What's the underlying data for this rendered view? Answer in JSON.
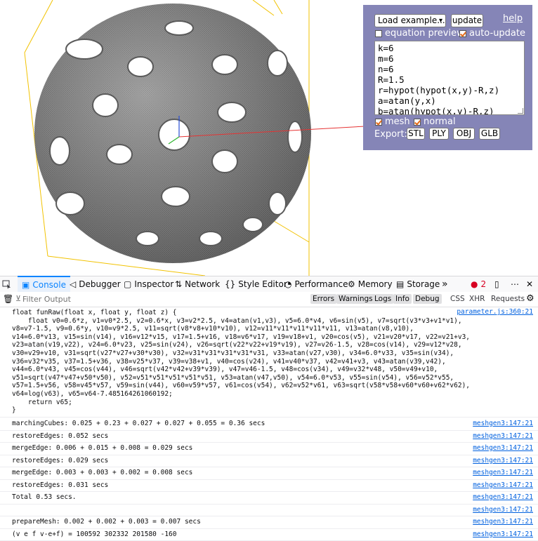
{
  "panel": {
    "example_select": "Load example...",
    "update_label": "update",
    "help_label": "help",
    "equation_preview_label": "equation preview",
    "equation_preview_checked": false,
    "auto_update_label": "auto-update",
    "auto_update_checked": true,
    "equation_lines": [
      "k=6",
      "m=6",
      "n=6",
      "R=1.5",
      "r=hypot(hypot(x,y)-R,z)",
      "a=atan(y,x)",
      "b=atan(hypot(x,y)-R,z)"
    ],
    "mesh_label": "mesh",
    "mesh_checked": true,
    "normal_label": "normal",
    "normal_checked": true,
    "export_label": "Export:",
    "export_buttons": [
      "STL",
      "PLY",
      "OBJ",
      "GLB"
    ],
    "background_color": "#8585b7"
  },
  "devtools": {
    "tabs": [
      {
        "label": "Console",
        "icon": "console-icon",
        "active": true
      },
      {
        "label": "Debugger",
        "icon": "debugger-icon"
      },
      {
        "label": "Inspector",
        "icon": "inspector-icon"
      },
      {
        "label": "Network",
        "icon": "network-icon"
      },
      {
        "label": "Style Editor",
        "icon": "style-editor-icon"
      },
      {
        "label": "Performance",
        "icon": "performance-icon"
      },
      {
        "label": "Memory",
        "icon": "memory-icon"
      },
      {
        "label": "Storage",
        "icon": "storage-icon"
      }
    ],
    "error_count": "2",
    "filter_placeholder": "Filter Output",
    "filters": [
      "Errors",
      "Warnings",
      "Logs",
      "Info",
      "Debug"
    ],
    "plain_filters": [
      "CSS",
      "XHR",
      "Requests"
    ],
    "accent_color": "#0a84ff"
  },
  "console": {
    "code_source": "parameter.js:360:21",
    "code_lines": [
      "float funRaw(float x, float y, float z) {",
      "    float v0=0.6*z, v1=v0*2.5, v2=0.6*x, v3=v2*2.5, v4=atan(v1,v3), v5=6.0*v4, v6=sin(v5), v7=sqrt(v3*v3+v1*v1),",
      "v8=v7-1.5, v9=0.6*y, v10=v9*2.5, v11=sqrt(v8*v8+v10*v10), v12=v11*v11*v11*v11*v11, v13=atan(v8,v10),",
      "v14=6.0*v13, v15=sin(v14), v16=v12*v15, v17=1.5+v16, v18=v6*v17, v19=v18+v1, v20=cos(v5), v21=v20*v17, v22=v21+v3,",
      "v23=atan(v19,v22), v24=6.0*v23, v25=sin(v24), v26=sqrt(v22*v22+v19*v19), v27=v26-1.5, v28=cos(v14), v29=v12*v28,",
      "v30=v29+v10, v31=sqrt(v27*v27+v30*v30), v32=v31*v31*v31*v31*v31, v33=atan(v27,v30), v34=6.0*v33, v35=sin(v34),",
      "v36=v32*v35, v37=1.5+v36, v38=v25*v37, v39=v38+v1, v40=cos(v24), v41=v40*v37, v42=v41+v3, v43=atan(v39,v42),",
      "v44=6.0*v43, v45=cos(v44), v46=sqrt(v42*v42+v39*v39), v47=v46-1.5, v48=cos(v34), v49=v32*v48, v50=v49+v10,",
      "v51=sqrt(v47*v47+v50*v50), v52=v51*v51*v51*v51*v51, v53=atan(v47,v50), v54=6.0*v53, v55=sin(v54), v56=v52*v55,",
      "v57=1.5+v56, v58=v45*v57, v59=sin(v44), v60=v59*v57, v61=cos(v54), v62=v52*v61, v63=sqrt(v58*v58+v60*v60+v62*v62),",
      "v64=log(v63), v65=v64-7.485164261060192;",
      "    return v65;",
      "}"
    ],
    "messages": [
      {
        "text": "marchingCubes: 0.025 + 0.23 + 0.027 + 0.027 + 0.055 = 0.36 secs",
        "source": "meshgen3:147:21"
      },
      {
        "text": "restoreEdges: 0.052 secs",
        "source": "meshgen3:147:21"
      },
      {
        "text": "mergeEdge: 0.006 + 0.015 + 0.008 = 0.029 secs",
        "source": "meshgen3:147:21"
      },
      {
        "text": "restoreEdges: 0.029 secs",
        "source": "meshgen3:147:21"
      },
      {
        "text": "mergeEdge: 0.003 + 0.003 + 0.002 = 0.008 secs",
        "source": "meshgen3:147:21"
      },
      {
        "text": "restoreEdges: 0.031 secs",
        "source": "meshgen3:147:21"
      },
      {
        "text": "Total 0.53 secs.",
        "source": "meshgen3:147:21"
      },
      {
        "text": "",
        "source": "meshgen3:147:21"
      },
      {
        "text": "prepareMesh: 0.002 + 0.002 + 0.003 = 0.007 secs",
        "source": "meshgen3:147:21"
      },
      {
        "text": "(v e f v-e+f) = 100592 302332 201580 -160",
        "source": "meshgen3:147:21"
      }
    ]
  }
}
